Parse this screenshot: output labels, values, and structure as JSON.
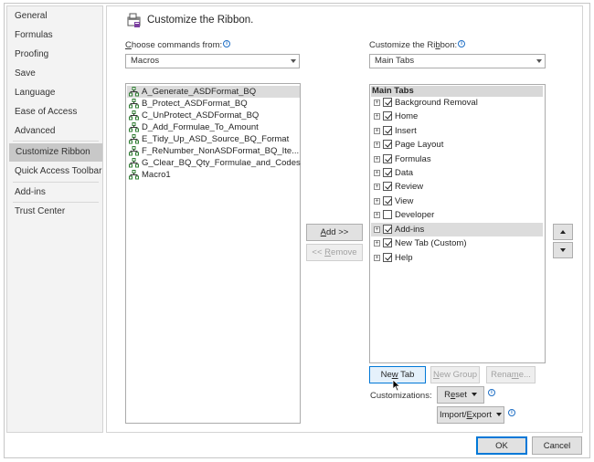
{
  "nav": {
    "items": [
      {
        "label": "General"
      },
      {
        "label": "Formulas"
      },
      {
        "label": "Proofing"
      },
      {
        "label": "Save"
      },
      {
        "label": "Language"
      },
      {
        "label": "Ease of Access"
      },
      {
        "label": "Advanced"
      },
      {
        "label": "Customize Ribbon",
        "selected": true
      },
      {
        "label": "Quick Access Toolbar"
      },
      {
        "label": "Add-ins"
      },
      {
        "label": "Trust Center"
      }
    ]
  },
  "header": {
    "title": "Customize the Ribbon."
  },
  "left": {
    "label_pre": "C",
    "label_rest": "hoose commands from:",
    "combo_value": "Macros",
    "items": [
      "A_Generate_ASDFormat_BQ",
      "B_Protect_ASDFormat_BQ",
      "C_UnProtect_ASDFormat_BQ",
      "D_Add_Formulae_To_Amount",
      "E_Tidy_Up_ASD_Source_BQ_Format",
      "F_ReNumber_NonASDFormat_BQ_Ite...",
      "G_Clear_BQ_Qty_Formulae_and_Codes",
      "Macro1"
    ]
  },
  "middle": {
    "add_label_u": "A",
    "add_label_rest": "dd >>",
    "remove_label_pre": "<< ",
    "remove_label_u": "R",
    "remove_label_rest": "emove"
  },
  "right": {
    "label_pre": "Customize the Ri",
    "label_u": "b",
    "label_rest": "bon:",
    "combo_value": "Main Tabs",
    "tree_header": "Main Tabs",
    "tabs": [
      {
        "label": "Background Removal",
        "checked": true
      },
      {
        "label": "Home",
        "checked": true
      },
      {
        "label": "Insert",
        "checked": true
      },
      {
        "label": "Page Layout",
        "checked": true
      },
      {
        "label": "Formulas",
        "checked": true
      },
      {
        "label": "Data",
        "checked": true
      },
      {
        "label": "Review",
        "checked": true
      },
      {
        "label": "View",
        "checked": true
      },
      {
        "label": "Developer",
        "checked": false
      },
      {
        "label": "Add-ins",
        "checked": true,
        "selected": true
      },
      {
        "label": "New Tab (Custom)",
        "checked": true
      },
      {
        "label": "Help",
        "checked": true
      }
    ]
  },
  "bottom": {
    "new_tab_pre": "Ne",
    "new_tab_u": "w",
    "new_tab_rest": " Tab",
    "new_group_pre": "",
    "new_group_u": "N",
    "new_group_rest": "ew Group",
    "rename_pre": "Rena",
    "rename_u": "m",
    "rename_rest": "e...",
    "customizations_label": "Customizations:",
    "reset_pre": "R",
    "reset_u": "e",
    "reset_rest": "set",
    "import_pre": "Import/",
    "import_u": "E",
    "import_rest": "xport"
  },
  "footer": {
    "ok_label": "OK",
    "cancel_label": "Cancel"
  },
  "colors": {
    "accent": "#0078d7",
    "selected": "#c8c8c8",
    "info": "#1f6fc5"
  }
}
